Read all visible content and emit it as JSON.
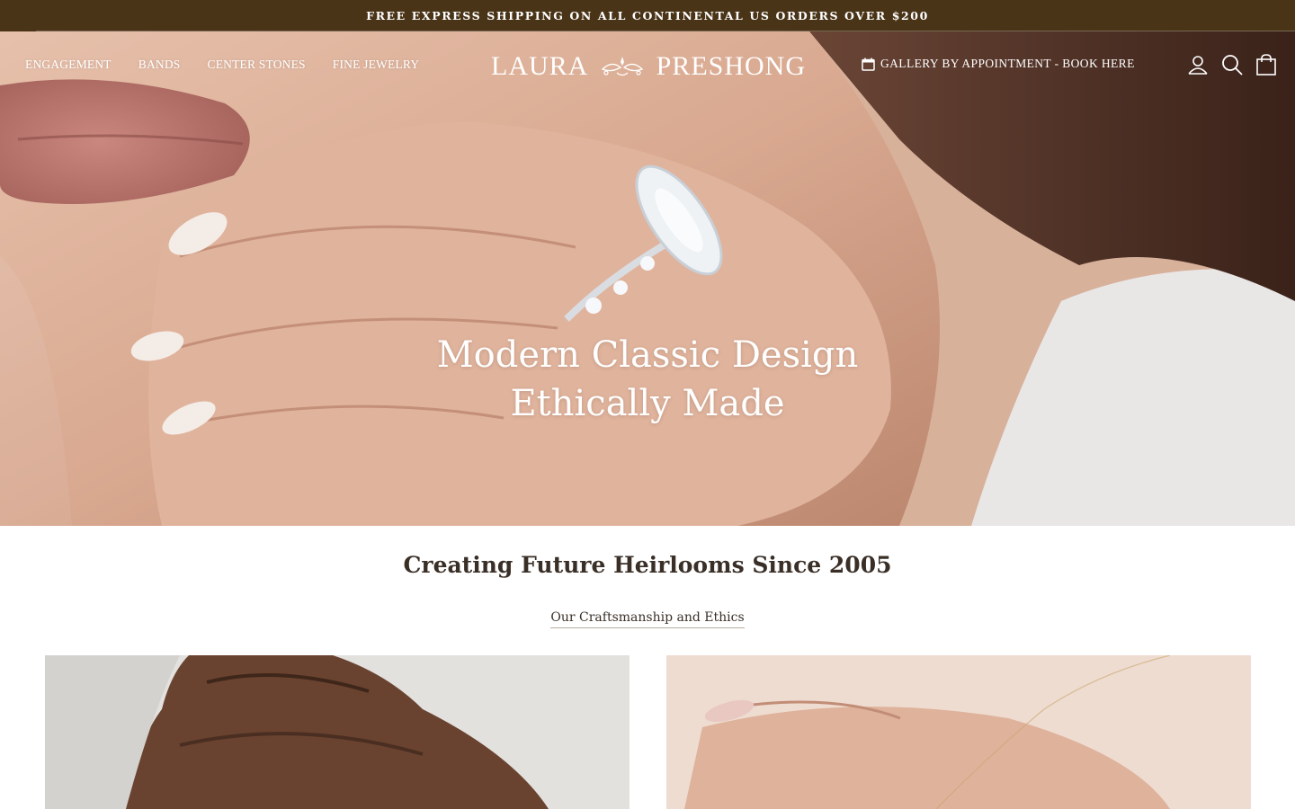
{
  "announcement": {
    "text": "FREE EXPRESS SHIPPING ON ALL CONTINENTAL US ORDERS OVER $200"
  },
  "nav": {
    "items": [
      {
        "label": "ENGAGEMENT"
      },
      {
        "label": "BANDS"
      },
      {
        "label": "CENTER STONES"
      },
      {
        "label": "FINE JEWELRY"
      }
    ]
  },
  "logo": {
    "left": "LAURA",
    "right": "PRESHONG"
  },
  "appointment": {
    "label": "GALLERY BY APPOINTMENT - BOOK HERE",
    "icon": "calendar-icon"
  },
  "header_icons": [
    "account-icon",
    "search-icon",
    "cart-icon"
  ],
  "hero": {
    "line1": "Modern Classic Design",
    "line2": "Ethically Made"
  },
  "intro": {
    "heading": "Creating Future Heirlooms Since 2005",
    "link": "Our Craftsmanship and Ethics"
  },
  "colors": {
    "announcement_bg": "#4a3418",
    "text_dark": "#3a2f27",
    "white": "#ffffff"
  }
}
